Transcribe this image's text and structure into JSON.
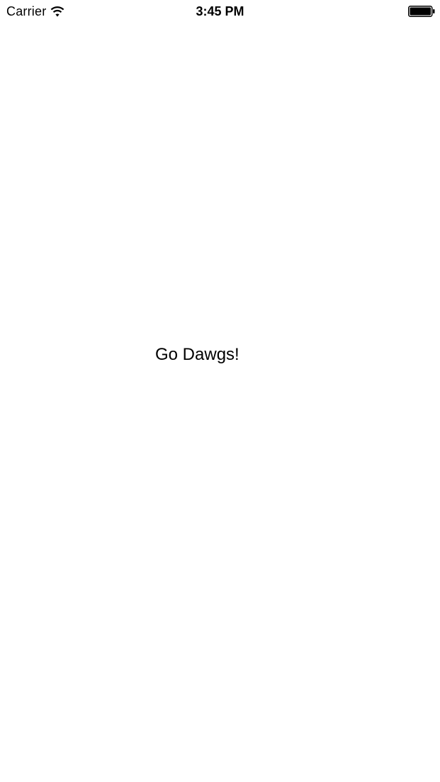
{
  "status_bar": {
    "carrier": "Carrier",
    "time": "3:45 PM",
    "icons": [
      "wifi-icon",
      "battery-icon"
    ]
  },
  "main": {
    "message": "Go Dawgs!"
  }
}
